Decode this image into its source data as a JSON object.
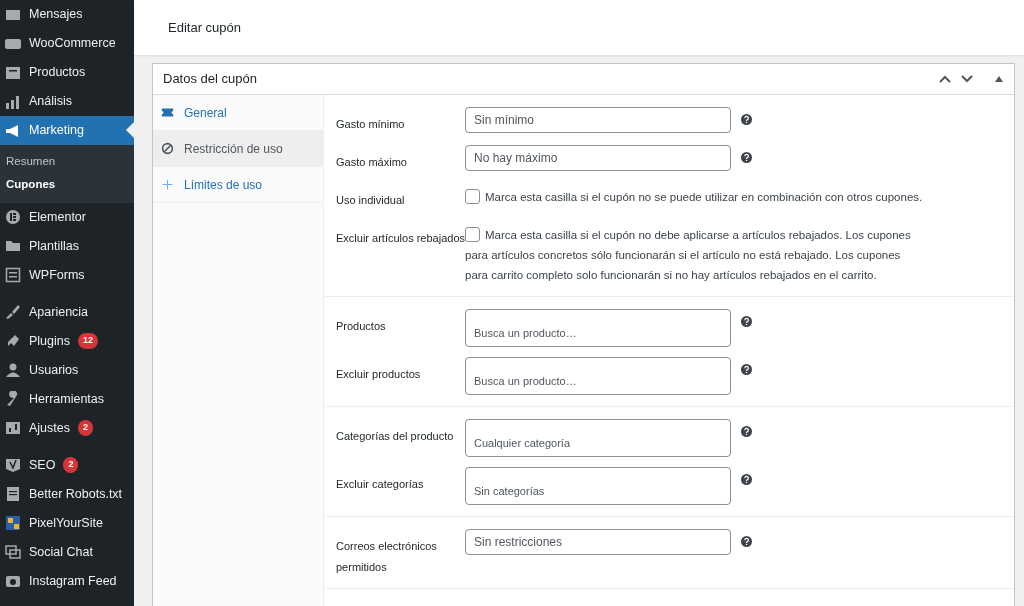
{
  "sidebar": {
    "groups": [
      [
        {
          "label": "Mensajes",
          "selected": false
        },
        {
          "label": "WooCommerce",
          "selected": false
        },
        {
          "label": "Productos",
          "selected": false
        },
        {
          "label": "Análisis",
          "selected": false
        },
        {
          "label": "Marketing",
          "selected": true,
          "children": [
            {
              "label": "Resumen",
              "selected": false
            },
            {
              "label": "Cupones",
              "selected": true
            }
          ]
        },
        {
          "label": "Elementor",
          "selected": false
        },
        {
          "label": "Plantillas",
          "selected": false
        },
        {
          "label": "WPForms",
          "selected": false
        }
      ],
      [
        {
          "label": "Apariencia",
          "selected": false
        },
        {
          "label": "Plugins",
          "selected": false,
          "badge": "12"
        },
        {
          "label": "Usuarios",
          "selected": false
        },
        {
          "label": "Herramientas",
          "selected": false
        },
        {
          "label": "Ajustes",
          "selected": false,
          "badge": "2"
        }
      ],
      [
        {
          "label": "SEO",
          "selected": false,
          "badge": "2"
        },
        {
          "label": "Better Robots.txt",
          "selected": false
        },
        {
          "label": "PixelYourSite",
          "selected": false
        },
        {
          "label": "Social Chat",
          "selected": false
        },
        {
          "label": "Instagram Feed",
          "selected": false
        }
      ]
    ]
  },
  "page_title": "Editar cupón",
  "panel": {
    "title": "Datos del cupón",
    "tabs": [
      {
        "label": "General",
        "selected": false
      },
      {
        "label": "Restricción de uso",
        "selected": true
      },
      {
        "label": "Límites de uso",
        "selected": false
      }
    ],
    "groups": [
      [
        {
          "kind": "text",
          "label": "Gasto mínimo",
          "placeholder": "Sin mínimo"
        },
        {
          "kind": "text",
          "label": "Gasto máximo",
          "placeholder": "No hay máximo"
        },
        {
          "kind": "checkbox",
          "label": "Uso individual",
          "checked": false,
          "text": "Marca esta casilla si el cupón no se puede utilizar en combinación con otros cupones."
        },
        {
          "kind": "checkbox",
          "label": "Excluir artículos rebajados",
          "checked": false,
          "text": "Marca esta casilla si el cupón no debe aplicarse a artículos rebajados. Los cupones para artículos concretos sólo funcionarán si el artículo no está rebajado. Los cupones para carrito completo solo funcionarán si no hay artículos rebajados en el carrito."
        }
      ],
      [
        {
          "kind": "select",
          "label": "Productos",
          "placeholder": "Busca un producto…"
        },
        {
          "kind": "select",
          "label": "Excluir productos",
          "placeholder": "Busca un producto…"
        }
      ],
      [
        {
          "kind": "select",
          "label": "Categorías del producto",
          "placeholder": "Cualquier categoría"
        },
        {
          "kind": "select",
          "label": "Excluir categorías",
          "placeholder": "Sin categorías"
        }
      ],
      [
        {
          "kind": "text",
          "label": "Correos electrónicos permitidos",
          "placeholder": "Sin restricciones"
        }
      ]
    ]
  }
}
